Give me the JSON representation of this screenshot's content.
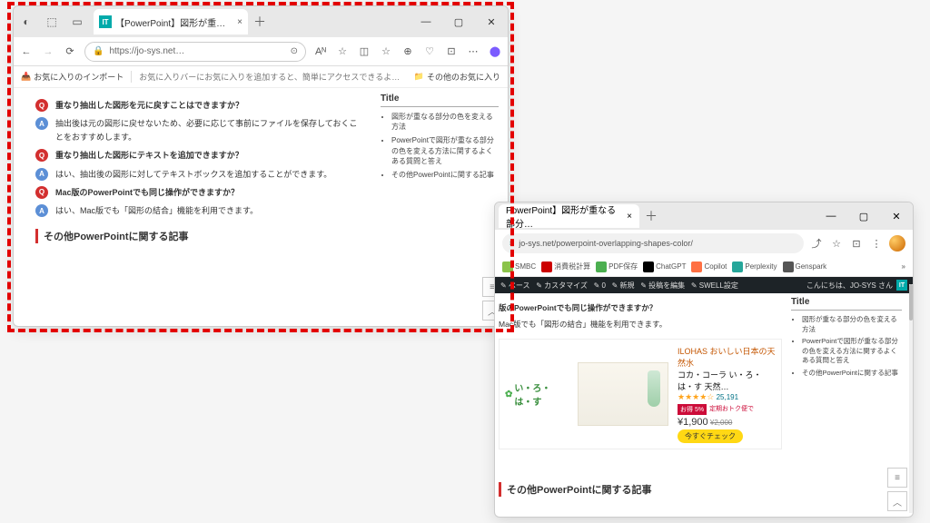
{
  "win1": {
    "tab_title": "【PowerPoint】図形が重なる部分の…",
    "tab_fav": "IT",
    "url": "https://jo-sys.net…",
    "fav_import": "お気に入りのインポート",
    "fav_msg": "お気に入りバーにお気に入りを追加すると、簡単にアクセスできるようになります。お気…",
    "fav_other": "その他のお気に入り",
    "qa": [
      {
        "q": "重なり抽出した図形を元に戻すことはできますか？",
        "a": "抽出後は元の図形に戻せないため、必要に応じて事前にファイルを保存しておくことをおすすめします。"
      },
      {
        "q": "重なり抽出した図形にテキストを追加できますか？",
        "a": "はい、抽出後の図形に対してテキストボックスを追加することができます。"
      },
      {
        "q": "Mac版のPowerPointでも同じ操作ができますか？",
        "a": "はい、Mac版でも「図形の結合」機能を利用できます。"
      }
    ],
    "sidebar_title": "Title",
    "sidebar_items": [
      "図形が重なる部分の色を変える方法",
      "PowerPointで図形が重なる部分の色を変える方法に関するよくある質問と答え",
      "その他PowerPointに関する記事"
    ],
    "section": "その他PowerPointに関する記事"
  },
  "win2": {
    "tab_title": "PowerPoint】図形が重なる部分…",
    "url": "jo-sys.net/powerpoint-overlapping-shapes-color/",
    "ext": [
      {
        "label": "SMBC",
        "color": "#8bc34a"
      },
      {
        "label": "消費税計算",
        "color": "#cc0000"
      },
      {
        "label": "PDF保存",
        "color": "#4caf50"
      },
      {
        "label": "ChatGPT",
        "color": "#000"
      },
      {
        "label": "Copilot",
        "color": "#ff7043"
      },
      {
        "label": "Perplexity",
        "color": "#26a69a"
      },
      {
        "label": "Genspark",
        "color": "#555"
      }
    ],
    "admin": {
      "items": [
        "ペース",
        "カスタマイズ",
        "0",
        "新規",
        "投稿を編集",
        "SWELL設定"
      ],
      "right": "こんにちは、JO-SYS さん",
      "badge": "IT"
    },
    "q": "版のPowerPointでも同じ操作ができますか？",
    "a": "Mac版でも「図形の結合」機能を利用できます。",
    "sidebar_title": "Title",
    "sidebar_items": [
      "図形が重なる部分の色を変える方法",
      "PowerPointで図形が重なる部分の色を変える方法に関するよくある質問と答え",
      "その他PowerPointに関する記事"
    ],
    "section": "その他PowerPointに関する記事",
    "ad": {
      "brand": "い・ろ・は・す",
      "headline": "ILOHAS おいしい日本の天然水",
      "subtitle": "コカ・コーラ い・ろ・は・す 天然…",
      "stars": "★★★★☆",
      "reviews": "25,191",
      "badge1": "お得 5%",
      "badge2": "定期おトク便で",
      "price": "¥1,900",
      "old": "¥2,000",
      "cta": "今すぐチェック"
    }
  }
}
